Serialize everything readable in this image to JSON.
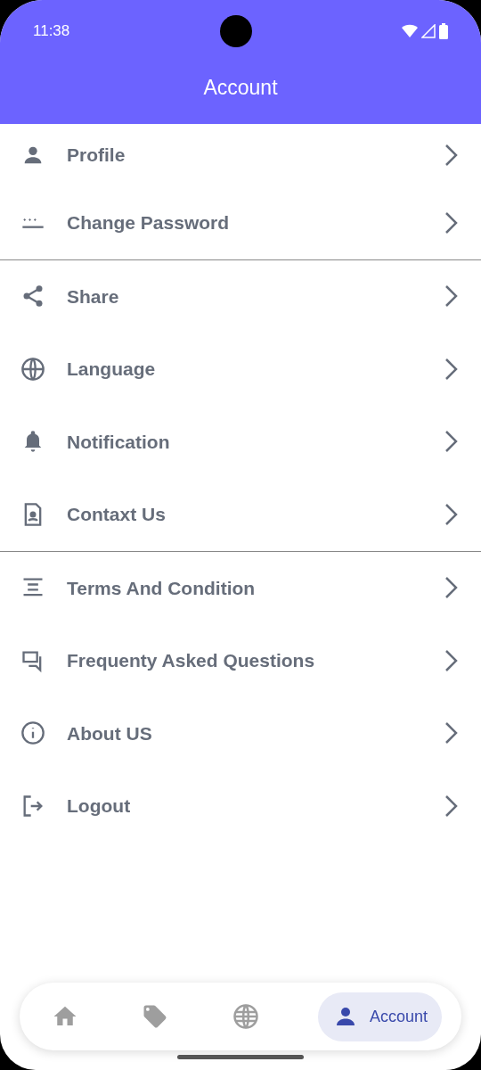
{
  "status_bar": {
    "time": "11:38"
  },
  "header": {
    "title": "Account"
  },
  "sections": [
    {
      "items": [
        {
          "label": "Profile"
        },
        {
          "label": "Change Password"
        }
      ]
    },
    {
      "items": [
        {
          "label": "Share"
        },
        {
          "label": "Language"
        },
        {
          "label": "Notification"
        },
        {
          "label": "Contaxt Us"
        }
      ]
    },
    {
      "items": [
        {
          "label": "Terms And Condition"
        },
        {
          "label": "Frequenty Asked Questions"
        },
        {
          "label": "About US"
        },
        {
          "label": "Logout"
        }
      ]
    }
  ],
  "bottom_nav": [
    {
      "selected": false
    },
    {
      "selected": false
    },
    {
      "selected": false
    },
    {
      "label": "Account",
      "selected": true
    }
  ]
}
